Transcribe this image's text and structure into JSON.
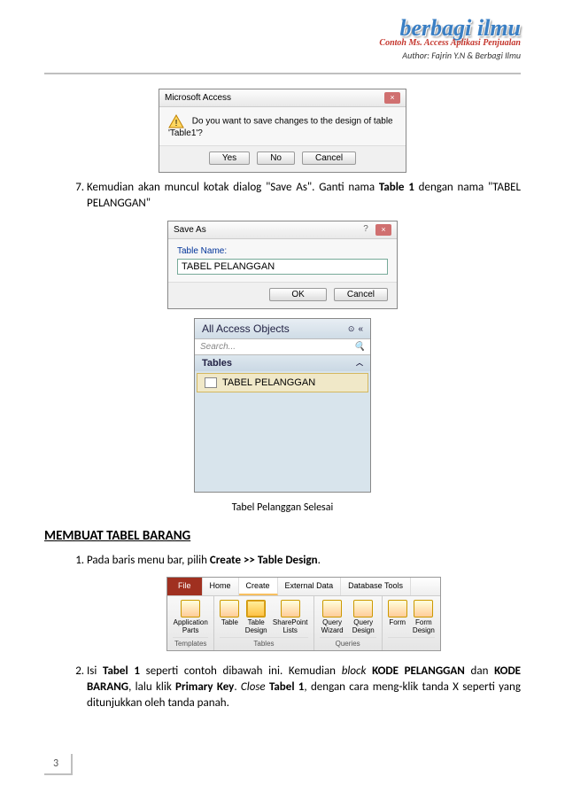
{
  "header": {
    "logo_main": "berbagi ilmu",
    "logo_sub": "Contoh Ms. Access Aplikasi Penjualan",
    "author": "Author: Fajrin Y.N & Berbagi Ilmu"
  },
  "dialog1": {
    "title": "Microsoft Access",
    "message": "Do you want to save changes to the design of table 'Table1'?",
    "btn_yes": "Yes",
    "btn_no": "No",
    "btn_cancel": "Cancel"
  },
  "step7": {
    "num": "7.",
    "text_pre": "Kemudian akan muncul kotak dialog \"Save As\". Ganti nama ",
    "bold1": "Table 1",
    "text_mid": " dengan nama \"TABEL PELANGGAN\""
  },
  "save_as": {
    "title": "Save As",
    "label": "Table Name:",
    "value": "TABEL PELANGGAN",
    "btn_ok": "OK",
    "btn_cancel": "Cancel"
  },
  "navpane": {
    "header": "All Access Objects",
    "search": "Search...",
    "group": "Tables",
    "item": "TABEL PELANGGAN"
  },
  "caption1": "Tabel Pelanggan Selesai",
  "heading2": "MEMBUAT TABEL BARANG",
  "step1": {
    "text_pre": "Pada baris menu bar, pilih ",
    "bold": "Create >> Table Design",
    "text_post": "."
  },
  "ribbon": {
    "tabs": {
      "file": "File",
      "home": "Home",
      "create": "Create",
      "external": "External Data",
      "dbtools": "Database Tools"
    },
    "g1": {
      "icon": "Application Parts",
      "label": "Templates"
    },
    "g2": {
      "i1": "Table",
      "i2": "Table Design",
      "i3": "SharePoint Lists",
      "label": "Tables"
    },
    "g3": {
      "i1": "Query Wizard",
      "i2": "Query Design",
      "label": "Queries"
    },
    "g4": {
      "i1": "Form",
      "i2": "Form Design",
      "label": ""
    }
  },
  "step2": {
    "text_pre": "Isi ",
    "bold1": "Tabel 1",
    "text_mid1": " seperti contoh dibawah ini. Kemudian ",
    "ital1": "block",
    "text_mid2": " ",
    "bold2": "KODE PELANGGAN",
    "text_mid3": " dan ",
    "bold3": "KODE BARANG",
    "text_mid4": ", lalu klik ",
    "bold4": "Primary Key",
    "text_mid5": ". ",
    "ital2": "Close",
    "text_mid6": " ",
    "bold5": "Tabel 1",
    "text_post": ", dengan cara meng-klik tanda X seperti yang ditunjukkan oleh tanda panah."
  },
  "page_number": "3"
}
